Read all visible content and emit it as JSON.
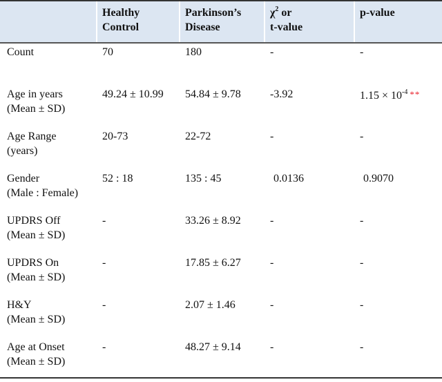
{
  "colors": {
    "header_bg": "#dce6f2",
    "significance_marker": "#e8202a"
  },
  "table": {
    "headers": [
      {
        "line1": "",
        "line2": ""
      },
      {
        "line1": "Healthy",
        "line2": "Control"
      },
      {
        "line1": "Parkinson’s",
        "line2": "Disease"
      },
      {
        "line1_main": "χ",
        "line1_sup": "2",
        "line1_rest": " or",
        "line2": "t-value"
      },
      {
        "line1": "p-value",
        "line2": ""
      }
    ],
    "rows": [
      {
        "label1": "Count",
        "label2": "",
        "hc": "70",
        "pd": "180",
        "stat": "-",
        "p": "-"
      },
      {
        "label1": "Age in years",
        "label2": "(Mean ± SD)",
        "hc": "49.24 ± 10.99",
        "pd": "54.84 ± 9.78",
        "stat": "-3.92",
        "p_main": "1.15 × 10",
        "p_exp": "-4",
        "p_marker": "**"
      },
      {
        "label1": "Age Range",
        "label2": "(years)",
        "hc": "20-73",
        "pd": "22-72",
        "stat": "-",
        "p": "-"
      },
      {
        "label1": "Gender",
        "label2": "(Male : Female)",
        "hc": "52 : 18",
        "pd": "135 : 45",
        "stat": "0.0136",
        "p": "0.9070"
      },
      {
        "label1": "UPDRS Off",
        "label2": "(Mean ± SD)",
        "hc": "-",
        "pd": "33.26 ± 8.92",
        "stat": "-",
        "p": "-"
      },
      {
        "label1": "UPDRS On",
        "label2": "(Mean ± SD)",
        "hc": "-",
        "pd": "17.85 ± 6.27",
        "stat": "-",
        "p": "-"
      },
      {
        "label1": "H&Y",
        "label2": "(Mean ± SD)",
        "hc": "-",
        "pd": "2.07 ± 1.46",
        "stat": "-",
        "p": "-"
      },
      {
        "label1": "Age at Onset",
        "label2": "(Mean ± SD)",
        "hc": "-",
        "pd": "48.27 ± 9.14",
        "stat": "-",
        "p": "-"
      }
    ]
  }
}
